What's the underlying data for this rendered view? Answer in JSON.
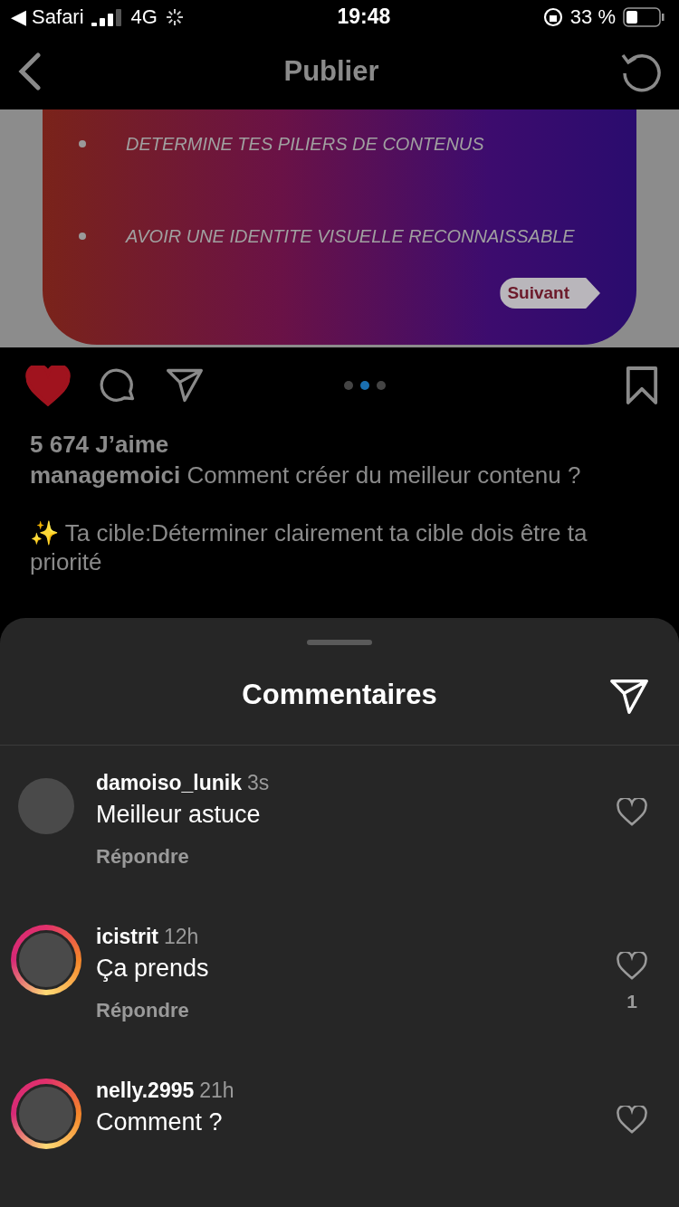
{
  "status_bar": {
    "back_app": "◀ Safari",
    "network": "4G",
    "time": "19:48",
    "battery": "33 %"
  },
  "nav": {
    "title": "Publier"
  },
  "post": {
    "slide": {
      "bullets": [
        "DETERMINE TES PILIERS DE CONTENUS",
        "AVOIR UNE IDENTITE VISUELLE RECONNAISSABLE"
      ],
      "next": "Suivant"
    },
    "liked": true,
    "saved": false,
    "dots": [
      {
        "selected": false
      },
      {
        "selected": true
      },
      {
        "selected": false
      }
    ],
    "likes": "5 674 J’aime",
    "author": "managemoici",
    "caption": "Comment créer du meilleur contenu ?",
    "caption_2": "✨ Ta cible:Déterminer clairement ta cible dois être ta priorité"
  },
  "comments_sheet": {
    "title": "Commentaires",
    "comments": [
      {
        "user": "damoiso_lunik",
        "time": "3s",
        "text": "Meilleur astuce",
        "reply": "Répondre",
        "story": false,
        "liked": false
      },
      {
        "user": "icistrit",
        "time": "12h",
        "text": "Ça prends",
        "reply": "Répondre",
        "likes": "1",
        "story": true,
        "liked": false
      },
      {
        "user": "nelly.2995",
        "time": "21h",
        "text": "Comment ?",
        "story": true,
        "liked": false
      }
    ]
  }
}
